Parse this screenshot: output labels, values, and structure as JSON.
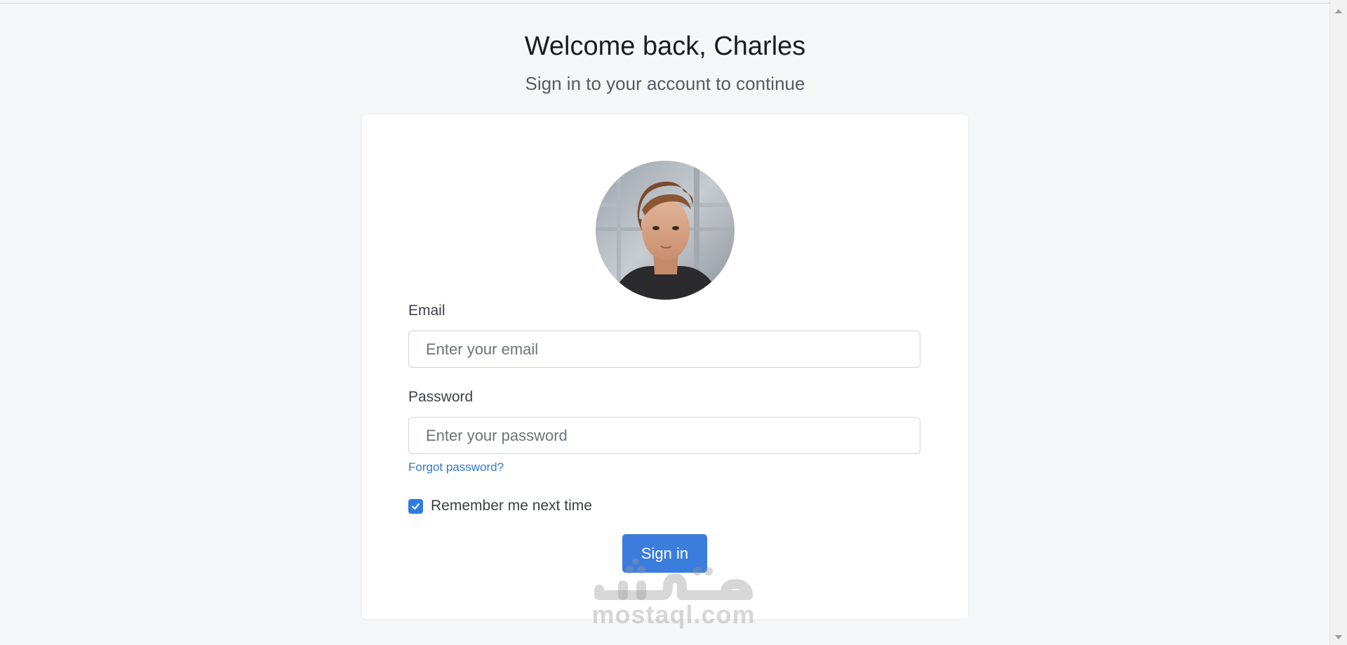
{
  "header": {
    "title": "Welcome back, Charles",
    "subtitle": "Sign in to your account to continue"
  },
  "form": {
    "email_label": "Email",
    "email_placeholder": "Enter your email",
    "email_value": "",
    "password_label": "Password",
    "password_placeholder": "Enter your password",
    "password_value": "",
    "forgot_link": "Forgot password?",
    "remember_label": "Remember me next time",
    "remember_checked": true,
    "submit_label": "Sign in"
  },
  "watermark": {
    "text": "mostaql.com"
  },
  "colors": {
    "page_bg": "#f5f6f8",
    "card_bg": "#ffffff",
    "primary": "#3b7ddd",
    "link": "#2f7ad6"
  },
  "icons": {
    "checkbox": "check-icon",
    "avatar": "user-avatar"
  }
}
